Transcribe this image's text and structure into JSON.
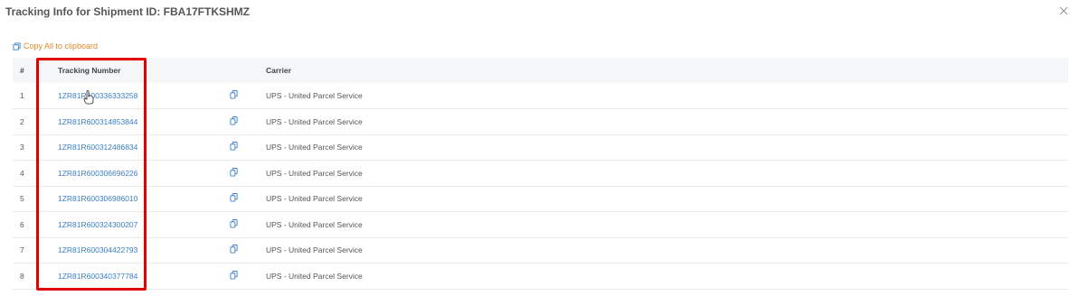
{
  "modal": {
    "title": "Tracking Info for Shipment ID: FBA17FTKSHMZ",
    "close_icon": "close-icon"
  },
  "copy_all": {
    "label": "Copy All to clipboard",
    "icon": "copy-icon",
    "color": "#e08a2c"
  },
  "table": {
    "headers": {
      "num": "#",
      "tracking": "Tracking Number",
      "copy": "",
      "carrier": "Carrier"
    },
    "rows": [
      {
        "num": "1",
        "tracking": "1ZR81R600336333258",
        "carrier": "UPS - United Parcel Service"
      },
      {
        "num": "2",
        "tracking": "1ZR81R600314853844",
        "carrier": "UPS - United Parcel Service"
      },
      {
        "num": "3",
        "tracking": "1ZR81R600312486834",
        "carrier": "UPS - United Parcel Service"
      },
      {
        "num": "4",
        "tracking": "1ZR81R600306696226",
        "carrier": "UPS - United Parcel Service"
      },
      {
        "num": "5",
        "tracking": "1ZR81R600306986010",
        "carrier": "UPS - United Parcel Service"
      },
      {
        "num": "6",
        "tracking": "1ZR81R600324300207",
        "carrier": "UPS - United Parcel Service"
      },
      {
        "num": "7",
        "tracking": "1ZR81R600304422793",
        "carrier": "UPS - United Parcel Service"
      },
      {
        "num": "8",
        "tracking": "1ZR81R600340377784",
        "carrier": "UPS - United Parcel Service"
      }
    ]
  },
  "colors": {
    "link": "#3a7fc4",
    "highlight": "#e00000",
    "header_bg": "#f4f6f8"
  }
}
